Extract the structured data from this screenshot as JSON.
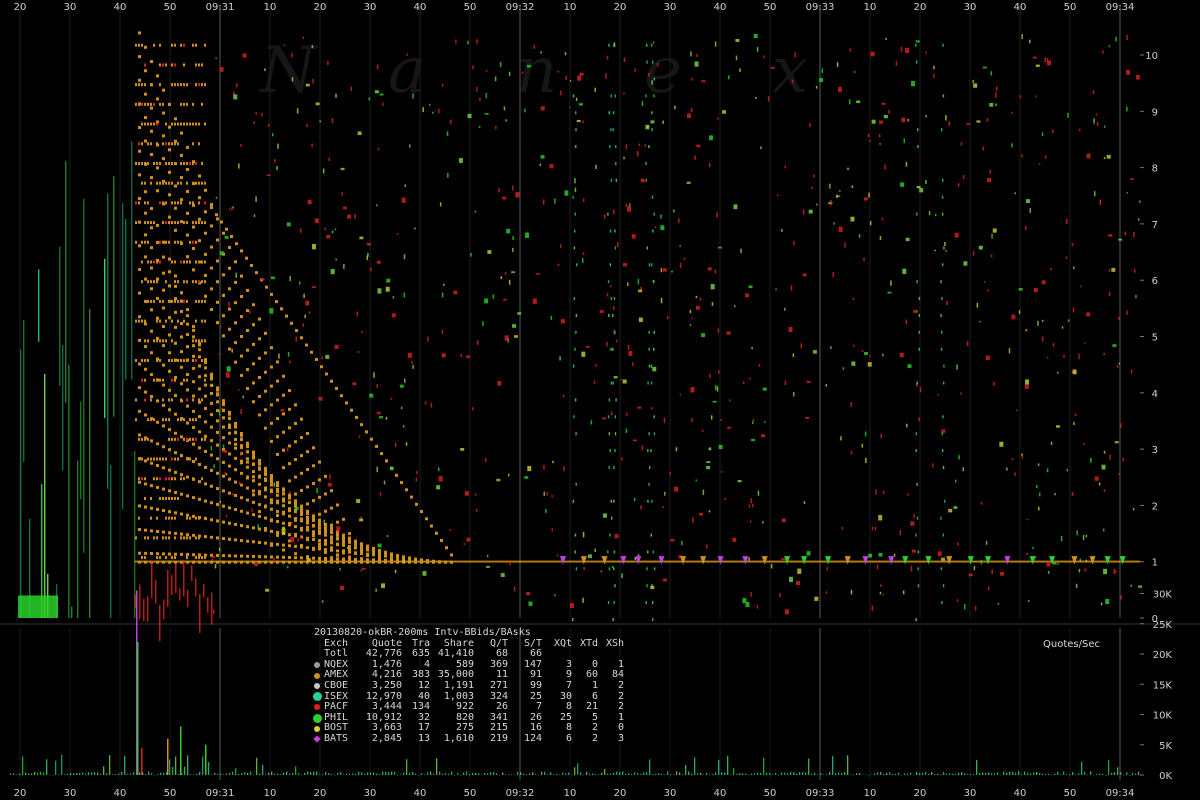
{
  "chart_data": {
    "type": "scatter",
    "title": "20130820-okBR-200ms Intv-BBids/BAsks",
    "watermark": "Nanex",
    "x_ticks": [
      "20",
      "30",
      "40",
      "50",
      "09:31",
      "10",
      "20",
      "30",
      "40",
      "50",
      "09:32",
      "10",
      "20",
      "30",
      "40",
      "50",
      "09:33",
      "10",
      "20",
      "30",
      "40",
      "50",
      "09:34"
    ],
    "upper_panel": {
      "y_ticks": [
        "0",
        "1",
        "2",
        "3",
        "4",
        "5",
        "6",
        "7",
        "8",
        "9",
        "10"
      ],
      "ylim": [
        0,
        10.6
      ]
    },
    "lower_panel": {
      "label": "Quotes/Sec",
      "y_ticks": [
        "0K",
        "5K",
        "10K",
        "15K",
        "20K",
        "25K",
        "30K"
      ],
      "ylim": [
        0,
        32000
      ]
    },
    "table": {
      "columns": [
        "Exch",
        "Quote",
        "Tra",
        "Share",
        "Q/T",
        "S/T",
        "XQt",
        "XTd",
        "XSh"
      ],
      "rows": [
        {
          "exch": "Totl",
          "quote": "42,776",
          "tra": "635",
          "share": "41,410",
          "qt": "68",
          "st": "66",
          "xqt": "",
          "xtd": "",
          "xsh": "",
          "color": "",
          "marker": "none"
        },
        {
          "exch": "NQEX",
          "quote": "1,476",
          "tra": "4",
          "share": "589",
          "qt": "369",
          "st": "147",
          "xqt": "3",
          "xtd": "0",
          "xsh": "1",
          "color": "#9a9a9a",
          "marker": "dot"
        },
        {
          "exch": "AMEX",
          "quote": "4,216",
          "tra": "383",
          "share": "35,000",
          "qt": "11",
          "st": "91",
          "xqt": "9",
          "xtd": "60",
          "xsh": "84",
          "color": "#d2901a",
          "marker": "dot"
        },
        {
          "exch": "CBOE",
          "quote": "3,250",
          "tra": "12",
          "share": "1,191",
          "qt": "271",
          "st": "99",
          "xqt": "7",
          "xtd": "1",
          "xsh": "2",
          "color": "#c8c8c8",
          "marker": "dot"
        },
        {
          "exch": "ISEX",
          "quote": "12,970",
          "tra": "40",
          "share": "1,003",
          "qt": "324",
          "st": "25",
          "xqt": "30",
          "xtd": "6",
          "xsh": "2",
          "color": "#22d49a",
          "marker": "big"
        },
        {
          "exch": "PACF",
          "quote": "3,444",
          "tra": "134",
          "share": "922",
          "qt": "26",
          "st": "7",
          "xqt": "8",
          "xtd": "21",
          "xsh": "2",
          "color": "#e02020",
          "marker": "dot"
        },
        {
          "exch": "PHIL",
          "quote": "10,912",
          "tra": "32",
          "share": "820",
          "qt": "341",
          "st": "26",
          "xqt": "25",
          "xtd": "5",
          "xsh": "1",
          "color": "#2ad22a",
          "marker": "big"
        },
        {
          "exch": "BOST",
          "quote": "3,663",
          "tra": "17",
          "share": "275",
          "qt": "215",
          "st": "16",
          "xqt": "8",
          "xtd": "2",
          "xsh": "0",
          "color": "#d0d030",
          "marker": "dot"
        },
        {
          "exch": "BATS",
          "quote": "2,845",
          "tra": "13",
          "share": "1,610",
          "qt": "219",
          "st": "124",
          "xqt": "6",
          "xtd": "2",
          "xsh": "3",
          "color": "#c040e0",
          "marker": "diamond"
        }
      ]
    }
  }
}
